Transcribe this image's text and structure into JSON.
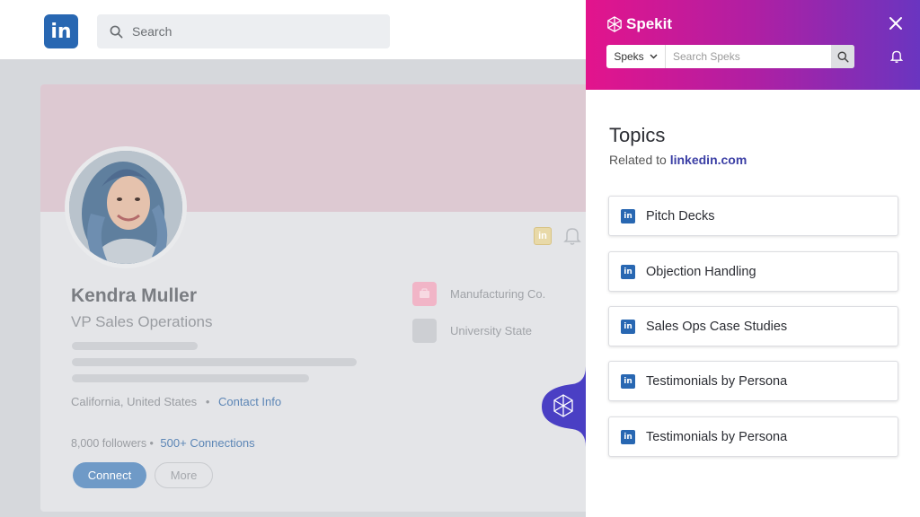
{
  "linkedin": {
    "logo": "in",
    "search_placeholder": "Search",
    "profile": {
      "name": "Kendra Muller",
      "title": "VP Sales Operations",
      "location": "California, United States",
      "separator": "•",
      "contact_info": "Contact Info",
      "followers": "8,000 followers •",
      "connections": "500+ Connections",
      "connect_label": "Connect",
      "more_label": "More"
    },
    "experience": [
      {
        "label": "Manufacturing Co.",
        "icon": "briefcase-icon",
        "color": "#f1a8bd"
      },
      {
        "label": "University State",
        "icon": "school-icon",
        "color": "#c9cbcf"
      }
    ],
    "mini_logo": "in"
  },
  "spekit": {
    "brand": "Spekit",
    "select_label": "Speks",
    "search_placeholder": "Search Speks",
    "topics_title": "Topics",
    "related_prefix": "Related to",
    "related_domain": "linkedin.com",
    "topics": [
      {
        "label": "Pitch Decks",
        "icon": "in"
      },
      {
        "label": "Objection Handling",
        "icon": "in"
      },
      {
        "label": "Sales Ops Case Studies",
        "icon": "in"
      },
      {
        "label": "Testimonials by Persona",
        "icon": "in"
      },
      {
        "label": "Testimonials by Persona",
        "icon": "in"
      }
    ],
    "colors": {
      "gradient_start": "#e3148c",
      "gradient_end": "#6a35c0",
      "launcher": "#4a3fc4",
      "link": "#3b3fa5"
    }
  }
}
